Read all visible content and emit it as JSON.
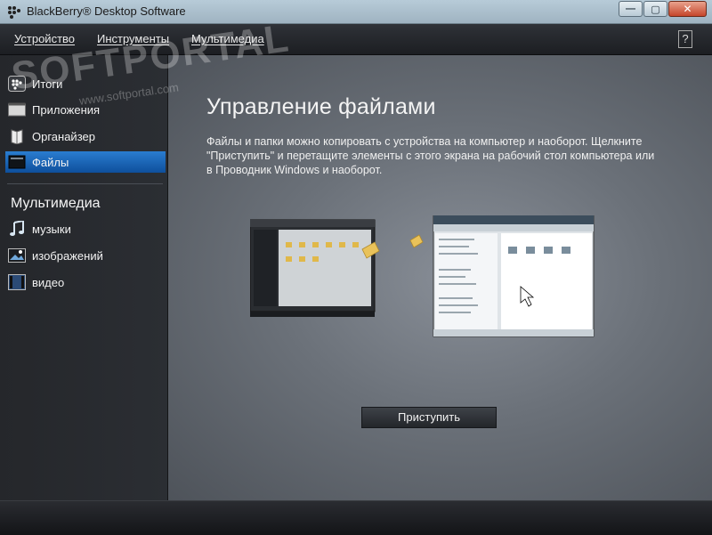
{
  "window": {
    "title": "BlackBerry® Desktop Software",
    "minimize_glyph": "—",
    "maximize_glyph": "▢",
    "close_glyph": "✕"
  },
  "menu": {
    "items": [
      "Устройство",
      "Инструменты",
      "Мультимедиа"
    ],
    "help_label": "?"
  },
  "sidebar": {
    "items": [
      {
        "label": "Итоги",
        "icon": "blackberry-logo-icon"
      },
      {
        "label": "Приложения",
        "icon": "applications-icon"
      },
      {
        "label": "Органайзер",
        "icon": "organizer-icon"
      },
      {
        "label": "Файлы",
        "icon": "files-icon",
        "active": true
      }
    ],
    "multimedia_title": "Мультимедиа",
    "media_items": [
      {
        "label": "музыки",
        "icon": "music-note-icon"
      },
      {
        "label": "изображений",
        "icon": "image-icon"
      },
      {
        "label": "видео",
        "icon": "video-icon"
      }
    ]
  },
  "main": {
    "title": "Управление файлами",
    "description": "Файлы и папки можно копировать с устройства на компьютер и наоборот. Щелкните \"Приступить\" и перетащите элементы с этого экрана на рабочий стол компьютера или в Проводник Windows и наоборот.",
    "start_button": "Приступить"
  },
  "watermark": {
    "text": "SOFTPORTAL",
    "sub": "www.softportal.com"
  },
  "colors": {
    "accent": "#1d66b8",
    "sidebar_bg": "#282a2f",
    "main_bg": "#6b7179"
  }
}
